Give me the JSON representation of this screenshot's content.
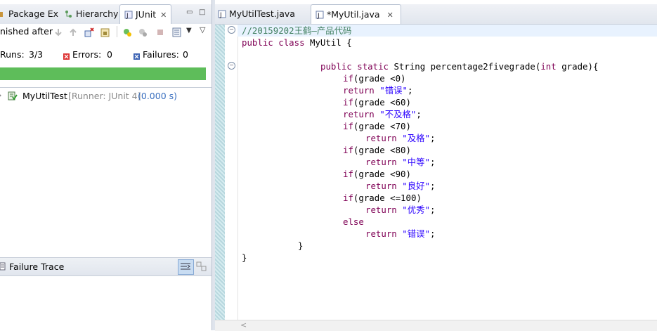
{
  "left_panel": {
    "tabs": [
      {
        "label": "Package Ex"
      },
      {
        "label": "Hierarchy"
      },
      {
        "label": "JUnit"
      }
    ],
    "status": "nished after",
    "runs_label": "Runs:",
    "runs_value": "3/3",
    "errors_label": "Errors:",
    "errors_value": "0",
    "failures_label": "Failures:",
    "failures_value": "0",
    "progress": 1.0,
    "test_suite": "MyUtilTest",
    "runner": "[Runner: JUnit 4]",
    "duration": "(0.000 s)",
    "failure_trace_title": "Failure Trace",
    "colors": {
      "progress": "#5ebd5a"
    }
  },
  "editor": {
    "tabs": [
      {
        "label": "MyUtilTest.java"
      },
      {
        "label": "*MyUtil.java"
      }
    ],
    "lines": [
      "//20159202王鹤—产品代码",
      "public class MyUtil {",
      "",
      "    public static String percentage2fivegrade(int grade){",
      "        if(grade <0)",
      "        return \"错误\";",
      "        if(grade <60)",
      "        return \"不及格\";",
      "        if(grade <70)",
      "            return \"及格\";",
      "        if(grade <80)",
      "            return \"中等\";",
      "        if(grade <90)",
      "            return \"良好\";",
      "        if(grade <=100)",
      "            return \"优秀\";",
      "        else",
      "            return \"错误\";",
      "    }",
      "}"
    ],
    "scroll_left_glyph": "<"
  }
}
